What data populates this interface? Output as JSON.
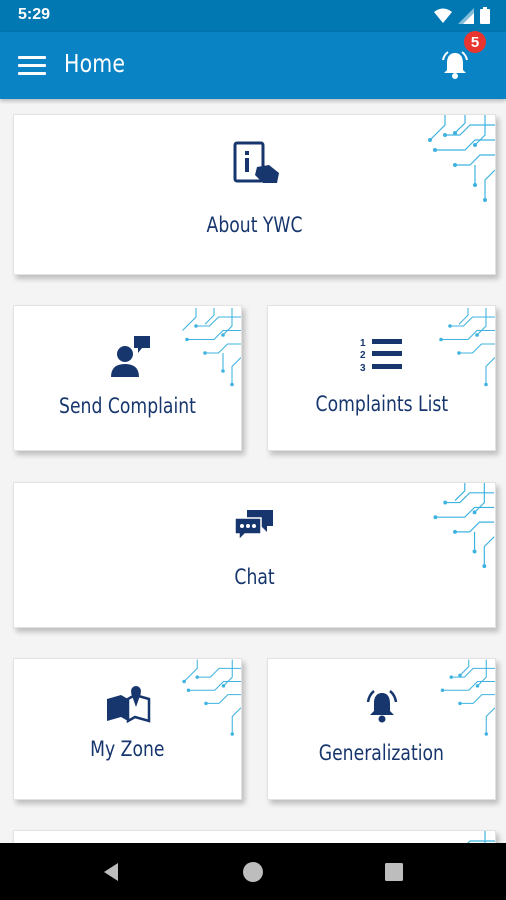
{
  "status_bar": {
    "time": "5:29"
  },
  "app_bar": {
    "title": "Home",
    "notification_count": "5"
  },
  "cards": {
    "about": "About YWC",
    "send_complaint": "Send Complaint",
    "complaints_list": "Complaints List",
    "chat": "Chat",
    "my_zone": "My Zone",
    "generalization": "Generalization"
  },
  "colors": {
    "status_bar": "#0278b2",
    "app_bar": "#0a83c5",
    "icon": "#17366d",
    "badge": "#e8352f",
    "circuit": "#3fb3e0"
  }
}
